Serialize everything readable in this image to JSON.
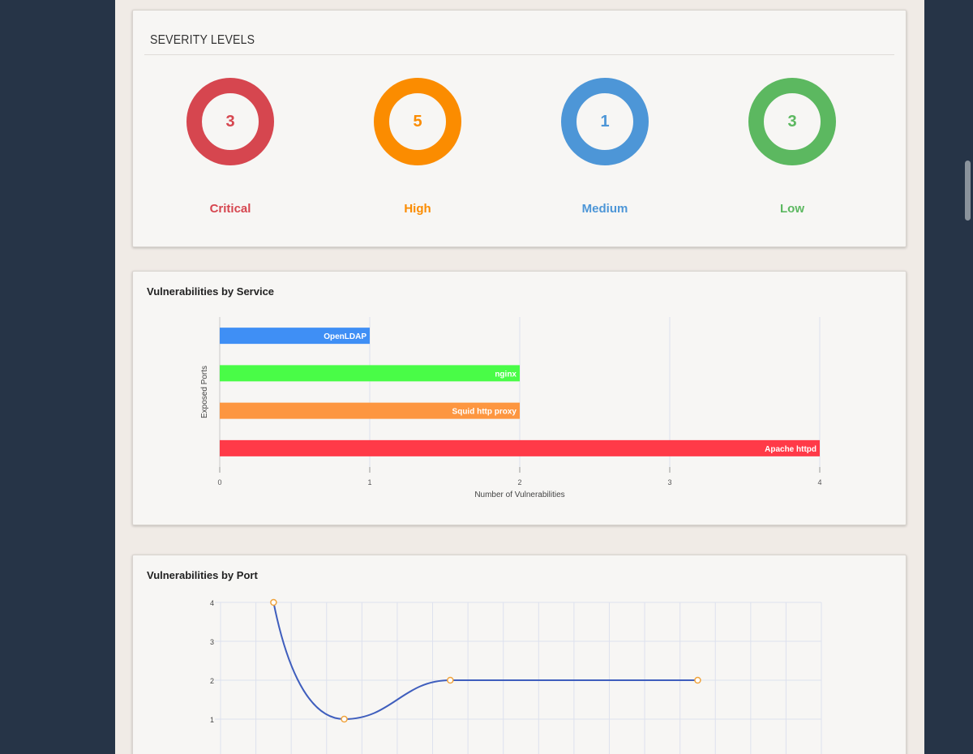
{
  "severity": {
    "title": "SEVERITY LEVELS",
    "items": [
      {
        "label": "Critical",
        "count": "3",
        "color": "#d6464f"
      },
      {
        "label": "High",
        "count": "5",
        "color": "#fb8c00"
      },
      {
        "label": "Medium",
        "count": "1",
        "color": "#4d96d7"
      },
      {
        "label": "Low",
        "count": "3",
        "color": "#5cb860"
      }
    ]
  },
  "service_chart": {
    "title": "Vulnerabilities by Service"
  },
  "port_chart": {
    "title": "Vulnerabilities by Port"
  },
  "chart_data": [
    {
      "type": "bar",
      "orientation": "horizontal",
      "title": "Vulnerabilities by Service",
      "xlabel": "Number of Vulnerabilities",
      "ylabel": "Exposed Ports",
      "categories": [
        "OpenLDAP",
        "nginx",
        "Squid http proxy",
        "Apache httpd"
      ],
      "values": [
        1,
        2,
        2,
        4
      ],
      "colors": [
        "#3f8ff5",
        "#49fc47",
        "#fd9640",
        "#ff3a48"
      ],
      "xlim": [
        0,
        4
      ],
      "xticks": [
        "0",
        "1",
        "2",
        "3",
        "4"
      ],
      "grid": true
    },
    {
      "type": "line",
      "title": "Vulnerabilities by Port",
      "series": [
        {
          "values": [
            4,
            1,
            2,
            2
          ],
          "color": "#3f5ebd",
          "point_color": "#f0a33c"
        }
      ],
      "x_index": [
        1.5,
        3.5,
        6.5,
        13.5
      ],
      "ylim": [
        0,
        4
      ],
      "yticks": [
        "1",
        "2",
        "3",
        "4"
      ],
      "smooth": true,
      "grid": true
    }
  ]
}
